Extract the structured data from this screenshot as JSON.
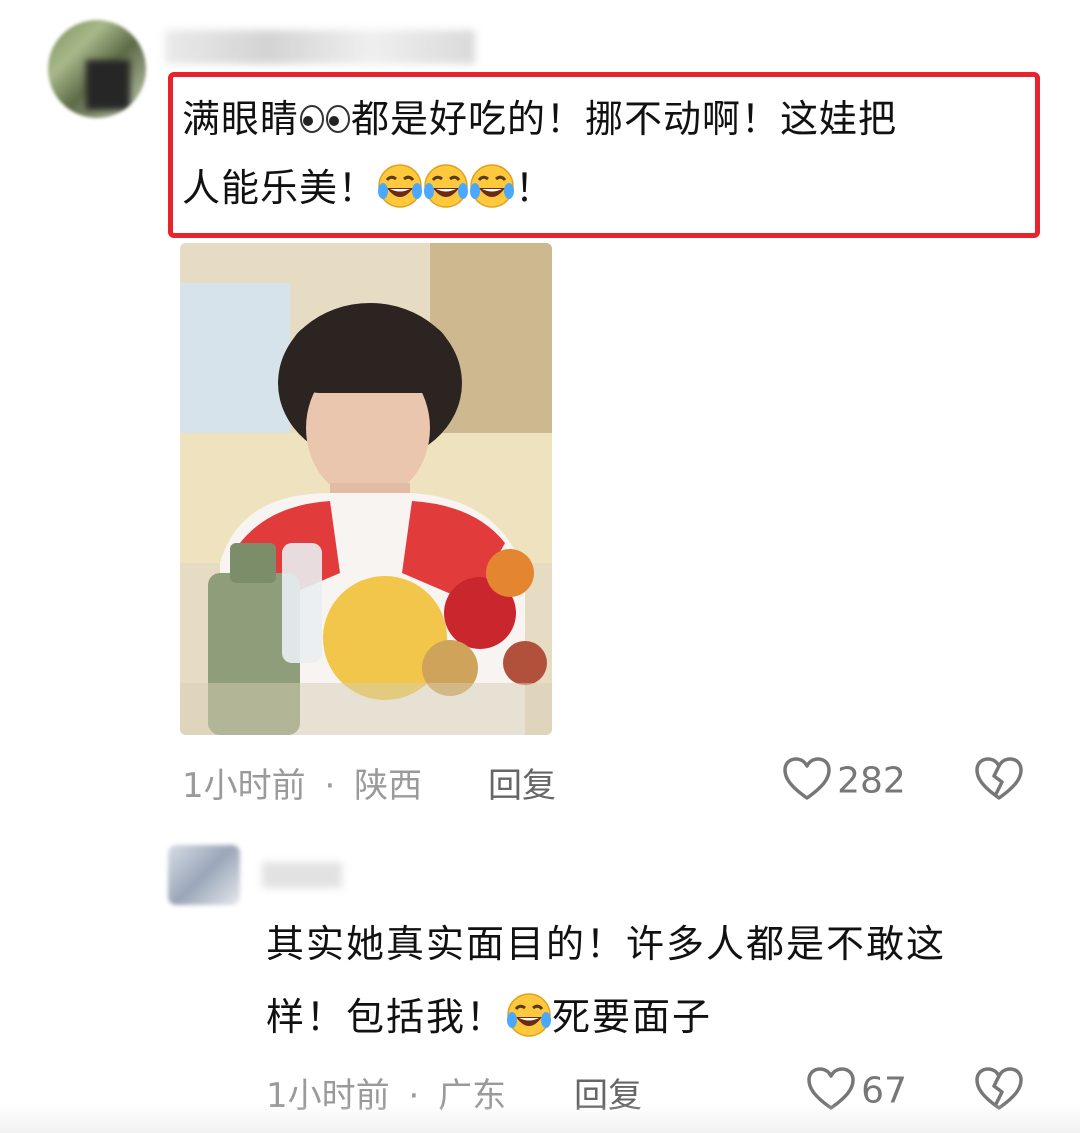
{
  "comment1": {
    "line1_a": "满眼睛",
    "eyes_icon": "eyes-emoji-icon",
    "line1_b": "都是好吃的！挪不动啊！这娃把",
    "line2_a": "人能乐美！",
    "emoji": "face-with-tears-of-joy-icon",
    "line2_b": "！",
    "time": "1小时前",
    "separator": "·",
    "location": "陕西",
    "reply": "回复",
    "likes": "282"
  },
  "comment2": {
    "line1": "其实她真实面目的！许多人都是不敢这",
    "line2_a": "样！包括我！",
    "emoji": "face-with-tears-of-joy-icon",
    "line2_b": "死要面子",
    "time": "1小时前",
    "separator": "·",
    "location": "广东",
    "reply": "回复",
    "likes": "67"
  },
  "colors": {
    "highlight_border": "#e8232c",
    "meta_text": "#9a9a9a",
    "icon_gray": "#777777"
  }
}
